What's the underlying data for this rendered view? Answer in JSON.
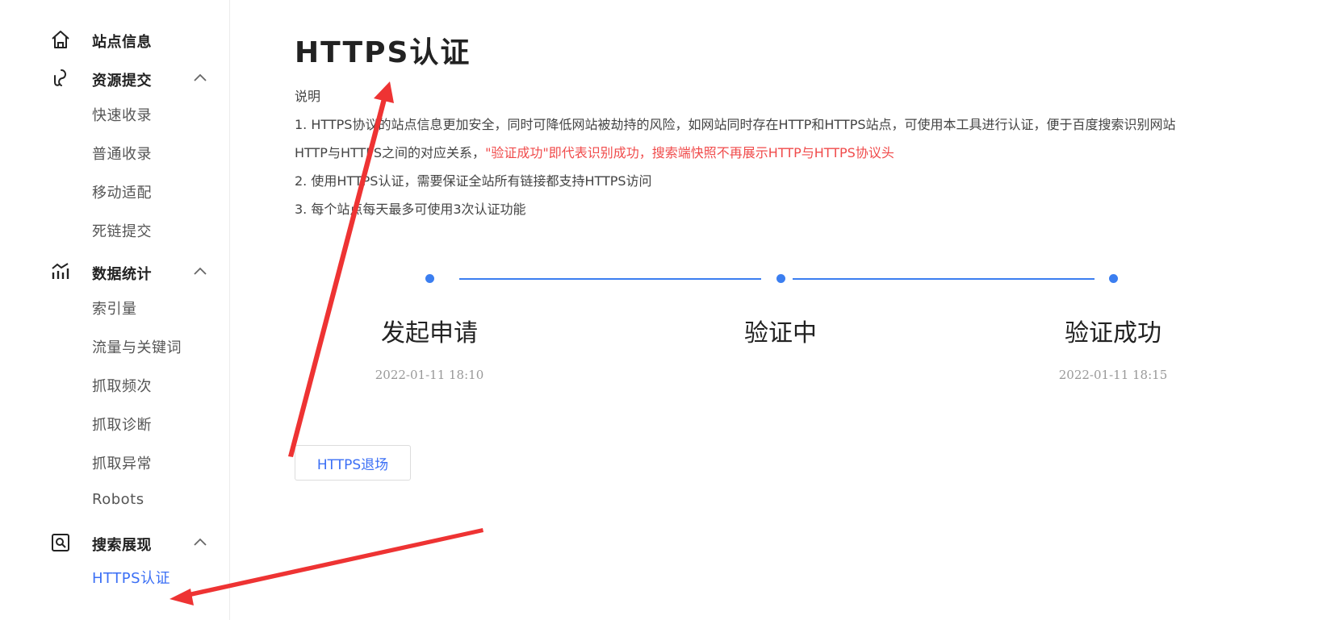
{
  "sidebar": {
    "groups": [
      {
        "label": "站点信息",
        "icon": "home-icon"
      },
      {
        "label": "资源提交",
        "icon": "submit-icon",
        "items": [
          "快速收录",
          "普通收录",
          "移动适配",
          "死链提交"
        ]
      },
      {
        "label": "数据统计",
        "icon": "chart-icon",
        "items": [
          "索引量",
          "流量与关键词",
          "抓取频次",
          "抓取诊断",
          "抓取异常",
          "Robots"
        ]
      },
      {
        "label": "搜索展现",
        "icon": "search-display-icon",
        "items": [
          "HTTPS认证"
        ]
      }
    ],
    "active_item": "HTTPS认证"
  },
  "main": {
    "title": "HTTPS认证",
    "desc_head": "说明",
    "desc": {
      "line1": "1. HTTPS协议的站点信息更加安全，同时可降低网站被劫持的风险，如网站同时存在HTTP和HTTPS站点，可使用本工具进行认证，便于百度搜索识别网站",
      "line2_normal": "HTTP与HTTPS之间的对应关系，",
      "line2_red": "\"验证成功\"即代表识别成功，搜索端快照不再展示HTTP与HTTPS协议头",
      "line3": "2. 使用HTTPS认证，需要保证全站所有链接都支持HTTPS访问",
      "line4": "3. 每个站点每天最多可使用3次认证功能"
    },
    "steps": [
      {
        "label": "发起申请",
        "time": "2022-01-11 18:10"
      },
      {
        "label": "验证中",
        "time": ""
      },
      {
        "label": "验证成功",
        "time": "2022-01-11 18:15"
      }
    ],
    "exit_button": "HTTPS退场"
  },
  "colors": {
    "accent": "#3b6ff5",
    "step_blue": "#3b7ef0",
    "warning_red": "#f04b4b",
    "annotation_red": "#ee3333"
  }
}
